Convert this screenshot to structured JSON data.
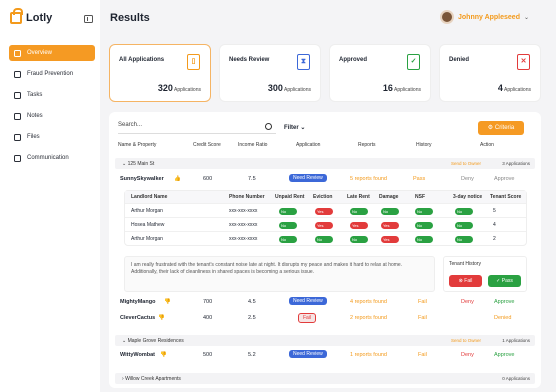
{
  "brand": {
    "name": "Lotly"
  },
  "sidebar": {
    "items": [
      {
        "label": "Overview",
        "icon": "grid-icon",
        "active": true
      },
      {
        "label": "Fraud Prevention",
        "icon": "house-icon"
      },
      {
        "label": "Tasks",
        "icon": "checklist-icon"
      },
      {
        "label": "Notes",
        "icon": "note-icon"
      },
      {
        "label": "Files",
        "icon": "file-icon"
      },
      {
        "label": "Communication",
        "icon": "chat-icon"
      }
    ]
  },
  "header": {
    "title": "Results",
    "user_name": "Johnny Appleseed"
  },
  "cards": [
    {
      "title": "All Applications",
      "count": "320",
      "unit": "Applications",
      "icon": "document-icon",
      "color": "#f39a1c"
    },
    {
      "title": "Needs Review",
      "count": "300",
      "unit": "Applications",
      "icon": "hourglass-icon",
      "color": "#3c68d8"
    },
    {
      "title": "Approved",
      "count": "16",
      "unit": "Applications",
      "icon": "check-document-icon",
      "color": "#2aa142"
    },
    {
      "title": "Denied",
      "count": "4",
      "unit": "Applications",
      "icon": "x-document-icon",
      "color": "#e23b3b"
    }
  ],
  "toolbar": {
    "search_placeholder": "Search...",
    "filter_label": "Filter",
    "criteria_label": "Criteria"
  },
  "columns": [
    "Name & Property",
    "Credit Score",
    "Income Ratio",
    "Application",
    "Reports",
    "History",
    "Action"
  ],
  "groups": [
    {
      "name": "125 Main St",
      "send": "Send to Owner",
      "count": "3 Applications"
    },
    {
      "name": "Maple Grove Residences",
      "send": "Send to Owner",
      "count": "1 Applications"
    },
    {
      "name": "Willow Creek Apartments",
      "count": "0 Applications"
    }
  ],
  "rows": [
    {
      "name": "SunnySkywalker",
      "credit": "600",
      "income": "7.5",
      "application": "Need Review",
      "reports": "5 reports found",
      "history": "Pass",
      "deny": "Deny",
      "approve": "Approve"
    },
    {
      "name": "MightyMango",
      "credit": "700",
      "income": "4.5",
      "application": "Need Review",
      "reports": "4 reports found",
      "history": "Fail",
      "deny": "Deny",
      "approve": "Approve"
    },
    {
      "name": "CleverCactus",
      "credit": "400",
      "income": "2.5",
      "application": "Fail",
      "reports": "2 reports found",
      "history": "Fail",
      "action": "Denied"
    },
    {
      "name": "WittyWombat",
      "credit": "500",
      "income": "5.2",
      "application": "Need Review",
      "reports": "1 reports found",
      "history": "Fail",
      "deny": "Deny",
      "approve": "Approve"
    }
  ],
  "landlord": {
    "headers": [
      "Landlord Name",
      "Phone Number",
      "Unpaid Rent",
      "Eviction",
      "Late Rent",
      "Damage",
      "NSF",
      "3-day notice",
      "Tenant Score"
    ],
    "rows": [
      {
        "name": "Arthur Morgan",
        "phone": "xxx-xxx-xxxx",
        "toggles": [
          "No",
          "Yes",
          "No",
          "No",
          "No",
          "No"
        ],
        "score": "5"
      },
      {
        "name": "Hosea Mathew",
        "phone": "xxx-xxx-xxxx",
        "toggles": [
          "No",
          "Yes",
          "Yes",
          "Yes",
          "No",
          "No"
        ],
        "score": "4"
      },
      {
        "name": "Arthur Morgan",
        "phone": "xxx-xxx-xxxx",
        "toggles": [
          "No",
          "No",
          "No",
          "Yes",
          "No",
          "No"
        ],
        "score": "2"
      }
    ],
    "note": "I am really frustrated with the tenant's constant noise late at night. It disrupts my peace and makes it hard to relax at home. Additionally, their lack of cleanliness in shared spaces is becoming a serious issue.",
    "history_title": "Tenant History",
    "fail_label": "Fail",
    "pass_label": "Pass"
  }
}
